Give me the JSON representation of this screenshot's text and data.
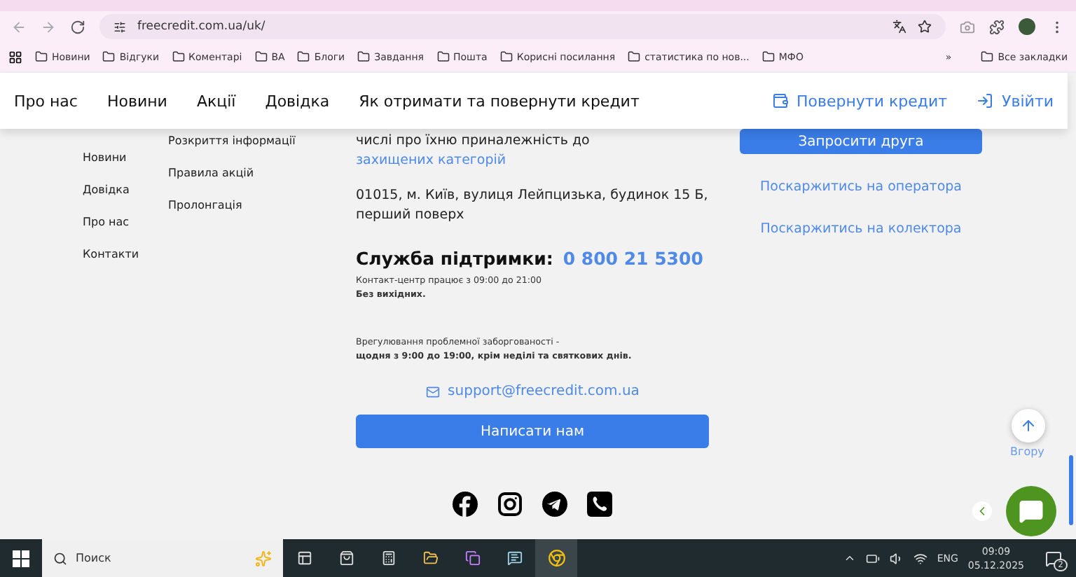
{
  "browser": {
    "url": "freecredit.com.ua/uk/",
    "bookmarks": [
      "Новини",
      "Відгуки",
      "Коментарі",
      "BA",
      "Блоги",
      "Завдання",
      "Пошта",
      "Корисні посилання",
      "статистика по нов...",
      "МФО"
    ],
    "more": "»",
    "all_bookmarks": "Все закладки"
  },
  "header": {
    "nav": [
      "Про нас",
      "Новини",
      "Акції",
      "Довідка",
      "Як отримати та повернути кредит"
    ],
    "repay": "Повернути кредит",
    "login": "Увійти"
  },
  "footer": {
    "col1": [
      "Новини",
      "Довідка",
      "Про нас",
      "Контакти"
    ],
    "col2": [
      "Розкриття інформації",
      "Правила акцій",
      "Пролонгація"
    ],
    "privacy_text": "числі про їхню приналежність до",
    "privacy_link": "захищених категорій",
    "address": "01015, м. Київ, вулиця Лейпцизька, будинок 15 Б, перший поверх",
    "support_label": "Служба підтримки:",
    "phone": "0 800 21 5300",
    "hours": "Контакт-центр працює з 09:00 до 21:00",
    "hours_note": "Без вихідних.",
    "debt_label": "Врегулювання проблемної заборгованості -",
    "debt_hours": "щодня з 9:00 до 19:00, крім неділі та святкових днів.",
    "email": "support@freecredit.com.ua",
    "write_button": "Написати нам",
    "invite_button": "Запросити друга",
    "complaints": [
      "Поскаржитись на оператора",
      "Поскаржитись на колектора"
    ]
  },
  "up_label": "Вгору",
  "taskbar": {
    "search_placeholder": "Поиск",
    "language": "ENG",
    "time": "09:09",
    "date": "05.12.2025",
    "notifications": "2"
  }
}
